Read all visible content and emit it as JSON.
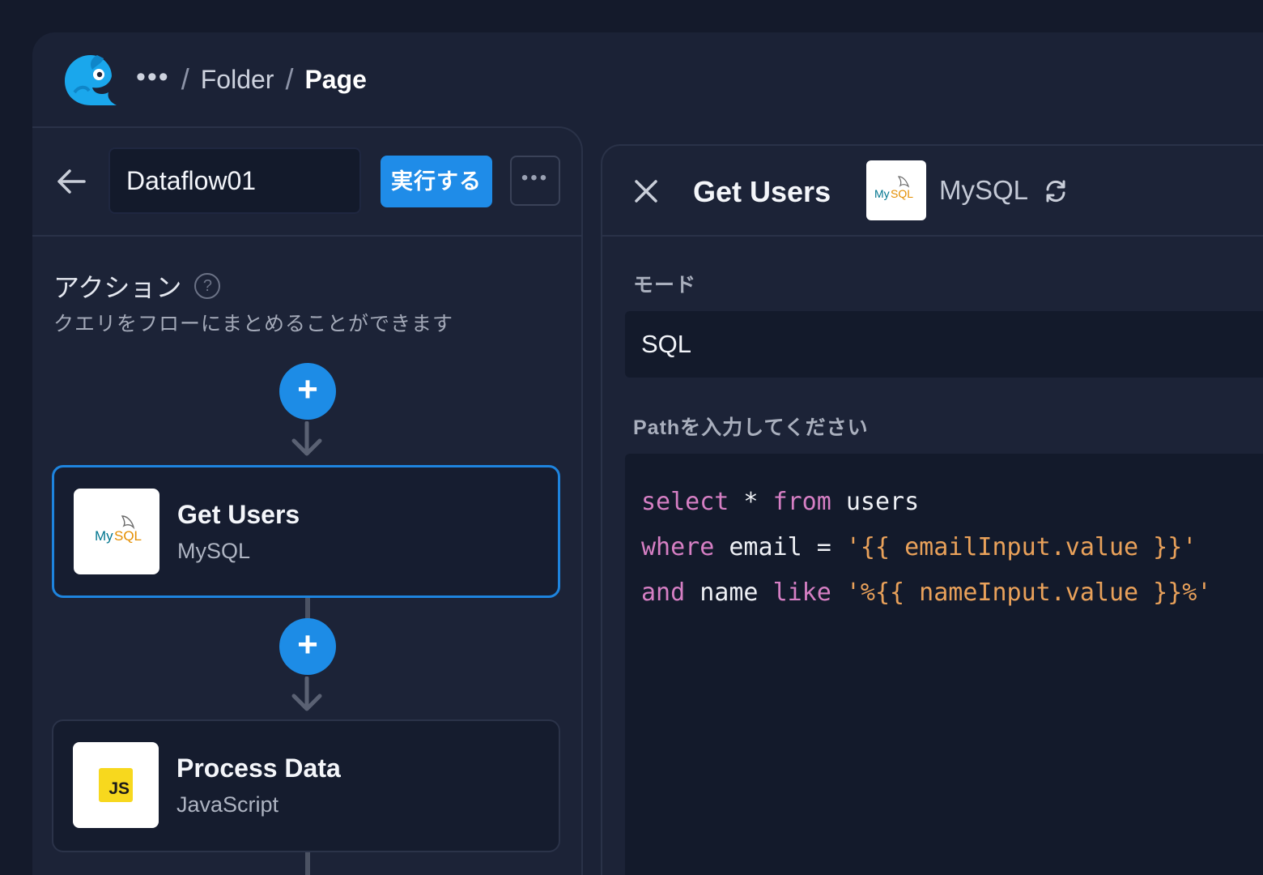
{
  "breadcrumb": {
    "more": "•••",
    "folder": "Folder",
    "page": "Page",
    "separator": "/"
  },
  "left_panel": {
    "flow_name": "Dataflow01",
    "run_label": "実行する",
    "more_label": "•••",
    "actions_title": "アクション",
    "help_label": "?",
    "actions_subtitle": "クエリをフローにまとめることができます",
    "add_label": "+",
    "cards": [
      {
        "title": "Get Users",
        "subtitle": "MySQL",
        "icon": "mysql-icon",
        "selected": true
      },
      {
        "title": "Process Data",
        "subtitle": "JavaScript",
        "icon": "javascript-icon",
        "selected": false
      }
    ],
    "js_badge": "JS"
  },
  "right_panel": {
    "title": "Get Users",
    "type": "MySQL",
    "mode_label": "モード",
    "mode_value": "SQL",
    "path_label": "Pathを入力してください",
    "code": {
      "line1": {
        "kw1": "select",
        "op": " * ",
        "kw2": "from",
        "rest": " users"
      },
      "line2": {
        "kw": "where",
        "mid": " email = ",
        "str": "'{{ emailInput.value }}'"
      },
      "line3": {
        "kw1": "and",
        "mid": " name ",
        "kw2": "like",
        "sp": " ",
        "str": "'%{{ nameInput.value }}%'"
      }
    }
  },
  "colors": {
    "accent": "#1f8ce8",
    "background": "#141a2b",
    "panel": "#1c2337",
    "keyword": "#d67fc4",
    "string": "#e9a15a",
    "js_yellow": "#f7d81e",
    "mysql_blue": "#00758f",
    "mysql_orange": "#e48e00"
  }
}
